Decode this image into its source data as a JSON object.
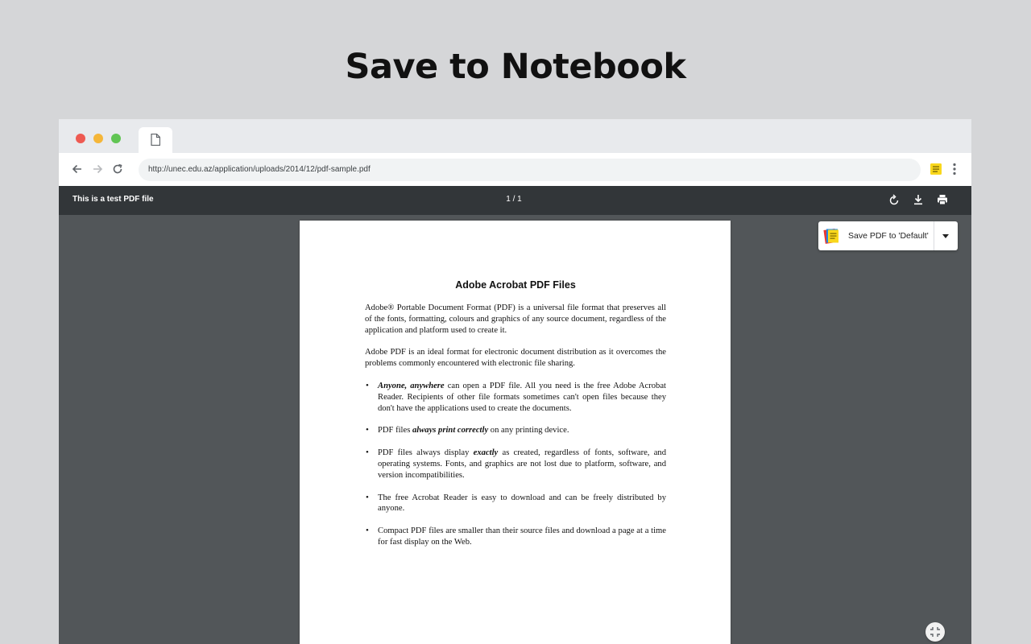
{
  "promo": {
    "title": "Save to Notebook"
  },
  "browser": {
    "url": "http://unec.edu.az/application/uploads/2014/12/pdf-sample.pdf"
  },
  "pdf_viewer": {
    "title": "This is a test PDF file",
    "page_indicator": "1 / 1"
  },
  "extension": {
    "save_label": "Save PDF to 'Default'",
    "icon_color": "#f9d71c"
  },
  "document": {
    "title": "Adobe Acrobat PDF Files",
    "para1": "Adobe® Portable Document Format (PDF) is a universal file format that preserves all of the fonts, formatting, colours and graphics of any source document, regardless of the application and platform used to create it.",
    "para2": "Adobe PDF is an ideal format for electronic document distribution as it overcomes the problems commonly encountered with electronic file sharing.",
    "b1_em": "Anyone, anywhere",
    "b1_rest": " can open a PDF file. All you need is the free Adobe Acrobat Reader. Recipients of other file formats sometimes can't open files because they don't have the applications used to create the documents.",
    "b2_pre": "PDF files ",
    "b2_em": "always print correctly",
    "b2_post": " on any printing device.",
    "b3_pre": "PDF files always display ",
    "b3_em": "exactly",
    "b3_post": " as created, regardless of fonts, software, and operating systems. Fonts, and graphics are not lost due to platform, software, and version incompatibilities.",
    "b4": "The free Acrobat Reader is easy to download and can be freely distributed by anyone.",
    "b5": "Compact PDF files are smaller than their source files and download a page at a time for fast display on the Web."
  }
}
